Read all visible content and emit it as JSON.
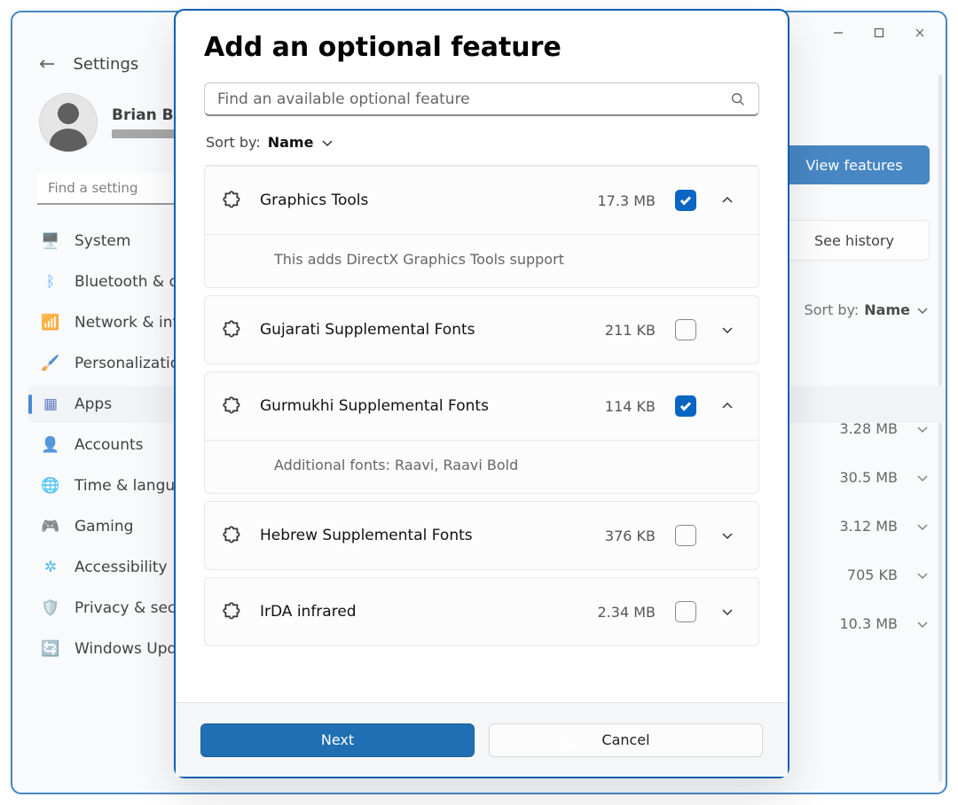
{
  "window": {
    "back_icon": "back-arrow",
    "app_title": "Settings",
    "user_name": "Brian Bur",
    "find_setting_placeholder": "Find a setting",
    "nav": [
      {
        "icon": "🖥️",
        "label": "System",
        "sel": false,
        "tint": "#3a86f0"
      },
      {
        "icon": "ᛒ",
        "label": "Bluetooth & d",
        "sel": false,
        "tint": "#2f8cff"
      },
      {
        "icon": "📶",
        "label": "Network & int",
        "sel": false,
        "tint": "#2f8cff"
      },
      {
        "icon": "🖌️",
        "label": "Personalizatio",
        "sel": false,
        "tint": "#6b6b6b"
      },
      {
        "icon": "▦",
        "label": "Apps",
        "sel": true,
        "tint": "#3354b0"
      },
      {
        "icon": "👤",
        "label": "Accounts",
        "sel": false,
        "tint": "#2f8cff"
      },
      {
        "icon": "🌐",
        "label": "Time & langua",
        "sel": false,
        "tint": "#2f8cff"
      },
      {
        "icon": "🎮",
        "label": "Gaming",
        "sel": false,
        "tint": "#7aa0c4"
      },
      {
        "icon": "✲",
        "label": "Accessibility",
        "sel": false,
        "tint": "#0aa3e6"
      },
      {
        "icon": "🛡️",
        "label": "Privacy & secu",
        "sel": false,
        "tint": "#8a8a8e"
      },
      {
        "icon": "🔄",
        "label": "Windows Upd",
        "sel": false,
        "tint": "#0aa3e6"
      }
    ],
    "right_panel": {
      "view_features": "View features",
      "see_history": "See history",
      "sort_label": "Sort by:",
      "sort_value": "Name",
      "bg_items": [
        {
          "size": "3.28 MB"
        },
        {
          "size": "30.5 MB"
        },
        {
          "size": "3.12 MB"
        },
        {
          "size": "705 KB"
        },
        {
          "size": "10.3 MB"
        }
      ]
    }
  },
  "modal": {
    "title": "Add an optional feature",
    "search_placeholder": "Find an available optional feature",
    "sort_label": "Sort by:",
    "sort_value": "Name",
    "features": [
      {
        "name": "Graphics Tools",
        "size": "17.3 MB",
        "checked": true,
        "expanded": true,
        "description": "This adds DirectX Graphics Tools support"
      },
      {
        "name": "Gujarati Supplemental Fonts",
        "size": "211 KB",
        "checked": false,
        "expanded": false
      },
      {
        "name": "Gurmukhi Supplemental Fonts",
        "size": "114 KB",
        "checked": true,
        "expanded": true,
        "description": "Additional fonts: Raavi, Raavi Bold"
      },
      {
        "name": "Hebrew Supplemental Fonts",
        "size": "376 KB",
        "checked": false,
        "expanded": false
      },
      {
        "name": "IrDA infrared",
        "size": "2.34 MB",
        "checked": false,
        "expanded": false
      }
    ],
    "next": "Next",
    "cancel": "Cancel"
  }
}
